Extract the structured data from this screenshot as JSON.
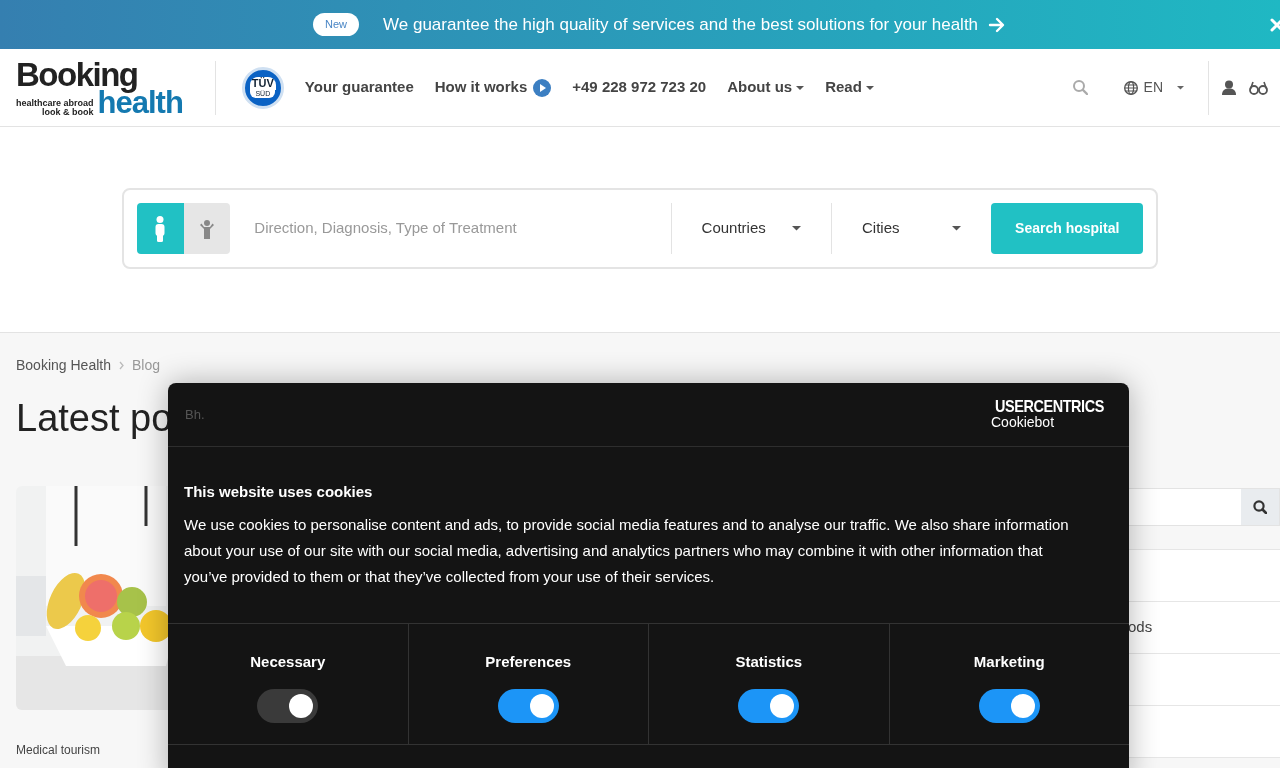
{
  "announcement": {
    "badge": "New",
    "text": "We guarantee the high quality of services and the best solutions for your health"
  },
  "header": {
    "logo": {
      "word1": "Booking",
      "word2": "health",
      "tagline1": "healthcare abroad",
      "tagline2": "look & book"
    },
    "certificate": {
      "line1": "TÜV",
      "line2": "SÜD"
    },
    "nav": [
      {
        "label": "Your guarantee",
        "kind": "link"
      },
      {
        "label": "How it works",
        "kind": "play"
      },
      {
        "label": "+49 228 972 723 20",
        "kind": "link"
      },
      {
        "label": "About us",
        "kind": "dropdown"
      },
      {
        "label": "Read",
        "kind": "dropdown"
      }
    ],
    "language": "EN"
  },
  "search": {
    "patients": [
      {
        "kind": "adult",
        "selected": true
      },
      {
        "kind": "child",
        "selected": false
      }
    ],
    "placeholder": "Direction, Diagnosis, Type of Treatment",
    "countries": "Countries",
    "cities": "Cities",
    "button": "Search hospital"
  },
  "breadcrumb": [
    "Booking Health",
    "Blog"
  ],
  "heading": "Latest po",
  "post": {
    "kind": "picture",
    "category": "Medical tourism"
  },
  "sidebar": {
    "items": [
      {
        "kind": "blank"
      },
      {
        "kind": "text",
        "label": "ods"
      },
      {
        "kind": "blank"
      },
      {
        "kind": "blank"
      }
    ]
  },
  "cookie_dialog": {
    "brand": "Bh.",
    "vendor": "USERCENTRICS",
    "product": "Cookiebot",
    "title": "This website uses cookies",
    "text": "We use cookies to personalise content and ads, to provide social media features and to analyse our traffic. We also share information about your use of our site with our social media, advertising and analytics partners who may combine it with other information that you’ve provided to them or that they’ve collected from your use of their services.",
    "categories": [
      {
        "label": "Necessary",
        "checked": true,
        "disabled": true
      },
      {
        "label": "Preferences",
        "checked": true,
        "disabled": false
      },
      {
        "label": "Statistics",
        "checked": true,
        "disabled": false
      },
      {
        "label": "Marketing",
        "checked": true,
        "disabled": false
      }
    ]
  }
}
